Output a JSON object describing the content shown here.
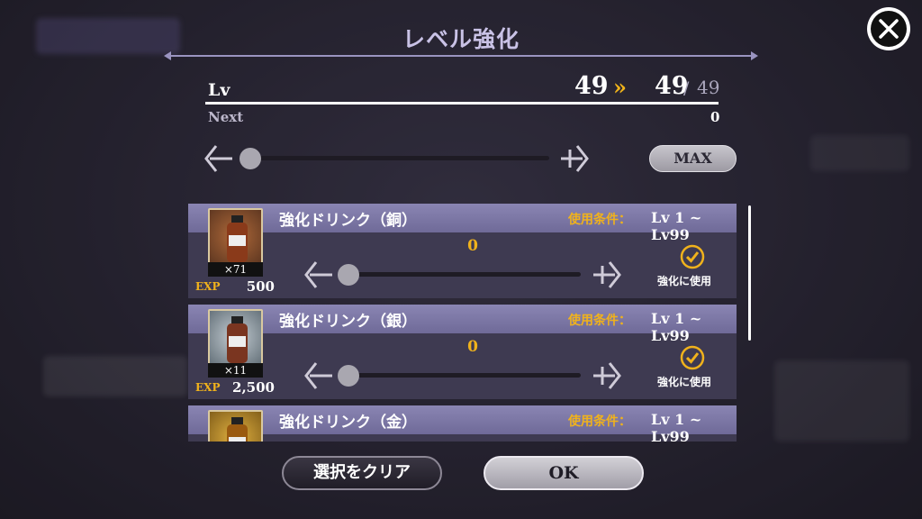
{
  "window": {
    "title": "レベル強化"
  },
  "level": {
    "label": "Lv",
    "current": "49",
    "arrow": "»",
    "after": "49",
    "slash": "/",
    "max": "49",
    "next_label": "Next",
    "next_value": "0"
  },
  "level_slider": {
    "value": 0
  },
  "max_button": "MAX",
  "items": [
    {
      "name": "強化ドリンク（銅）",
      "condition_label": "使用条件：",
      "condition_range": "Lv 1 ~ Lv99",
      "count": "×71",
      "exp_label": "EXP",
      "exp_value": "500",
      "quantity": "0",
      "use_label": "強化に使用",
      "bottle_color": "#8a3a1a"
    },
    {
      "name": "強化ドリンク（銀）",
      "condition_label": "使用条件：",
      "condition_range": "Lv 1 ~ Lv99",
      "count": "×11",
      "exp_label": "EXP",
      "exp_value": "2,500",
      "quantity": "0",
      "use_label": "強化に使用",
      "bottle_color": "#7a3520"
    },
    {
      "name": "強化ドリンク（金）",
      "condition_label": "使用条件：",
      "condition_range": "Lv 1 ~ Lv99",
      "bottle_color": "#9a5a10"
    }
  ],
  "buttons": {
    "clear": "選択をクリア",
    "ok": "OK"
  },
  "colors": {
    "accent": "#f0b21c",
    "panel": "#3e3a51",
    "header": "#7d78a6"
  }
}
